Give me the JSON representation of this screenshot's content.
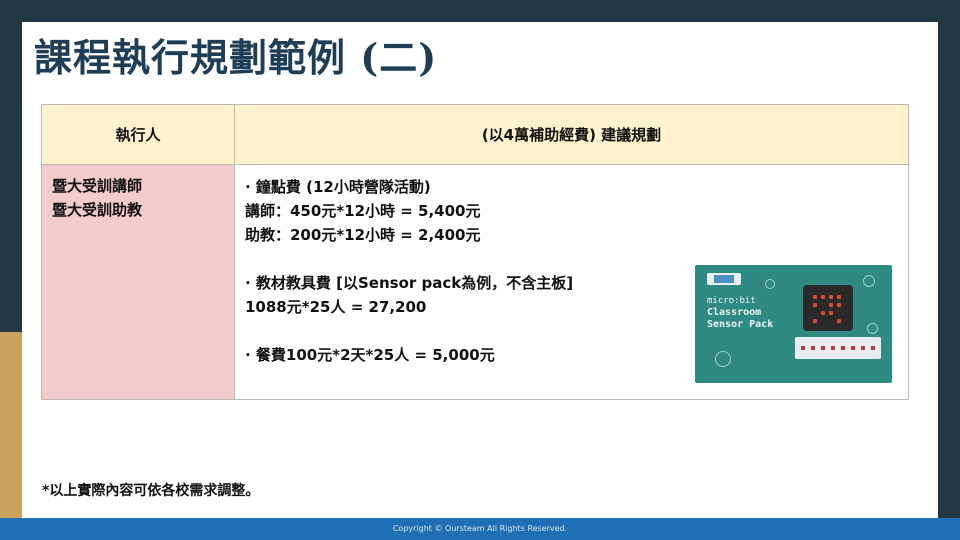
{
  "slide": {
    "title": "課程執行規劃範例 (二)"
  },
  "table": {
    "headers": [
      "執行人",
      "(以4萬補助經費) 建議規劃"
    ],
    "roles": [
      "暨大受訓講師",
      "暨大受訓助教"
    ],
    "details": [
      "· 鐘點費 (12小時營隊活動)",
      "講師：450元*12小時 = 5,400元",
      "助教：200元*12小時 = 2,400元",
      "",
      "· 教材教具費 [以Sensor pack為例，不含主板]",
      "1088元*25人 = 27,200",
      "",
      "· 餐費100元*2天*25人 = 5,000元"
    ]
  },
  "product_image": {
    "brand": "micro:bit",
    "name_line1": "Classroom",
    "name_line2": "Sensor Pack",
    "colors": {
      "background": "#2f8a82",
      "board": "#2a2a2a",
      "led": "#e04a2e"
    }
  },
  "footnote": "*以上實際內容可依各校需求調整。",
  "footer": {
    "copyright": "Copyright © Oursteam All Rights Reserved."
  },
  "colors": {
    "frame": "#243745",
    "accent_gold": "#c9a35d",
    "title": "#1f3e55",
    "header_bg": "#fff2cc",
    "role_bg": "#f4cccc",
    "footer_bg": "#1f6fb5"
  }
}
